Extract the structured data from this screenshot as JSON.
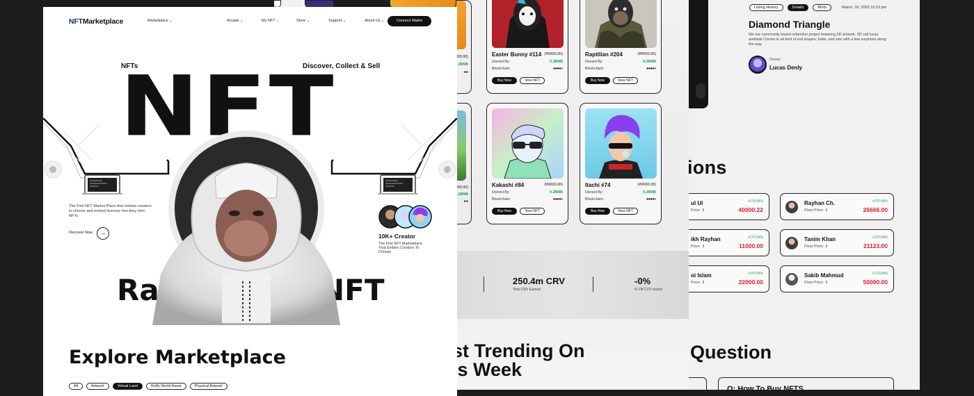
{
  "main": {
    "logo_nft": "NFT",
    "logo_rest": "Marketplace",
    "nav": [
      "Marketplace",
      "Arcade",
      "My NFT",
      "Store",
      "Support",
      "About Us"
    ],
    "connect_button": "Connect Wallet",
    "label_left": "NFTs",
    "label_right": "Discover, Collect & Sell",
    "hero_big_text": "NFT",
    "hero_bottom_left": "Rar",
    "hero_bottom_right": "NFT",
    "intro_text": "The First NFT Market Place that embles creators to choose and embed licenses hen they mint NFTs",
    "discover_link": "Discover Now",
    "discover_arrow": "→",
    "creator_count": "10K+ Creator",
    "creator_desc": "The First NFT Marketplace That Embles Creators To Choose.",
    "explore_title": "Explore Marketplace",
    "filters": [
      "All",
      "Artwork",
      "Virtual Land",
      "Ruffy World Asset",
      "Physical Artwork"
    ],
    "active_filter": "Virtual Land"
  },
  "middle": {
    "cards": [
      {
        "name": "Easter Bunny #114",
        "price": "(¥9000.00)",
        "owned_label": "Owned By:",
        "owned_value": "0.2BNB",
        "chain_label": "Blockchain:",
        "buy": "Buy Now",
        "view": "View NFT"
      },
      {
        "name": "Raptilian #204",
        "price": "(¥9000.00)",
        "owned_label": "Owned By:",
        "owned_value": "0.2BNB",
        "chain_label": "Blockchain:",
        "buy": "Buy Now",
        "view": "View NFT"
      },
      {
        "name": "Kakashi #84",
        "price": "(¥9000.00)",
        "owned_label": "Owned By:",
        "owned_value": "0.2BNB",
        "chain_label": "Blockchain:",
        "buy": "Buy Now",
        "view": "View NFT"
      },
      {
        "name": "Itachi #74",
        "price": "(¥9000.00)",
        "owned_label": "Owned By:",
        "owned_value": "0.2BNB",
        "chain_label": "Blockchain:",
        "buy": "Buy Now",
        "view": "View NFT"
      }
    ],
    "partial": [
      {
        "price": "9000.00)",
        "value": "0.2BNB"
      },
      {
        "price": "9000.00)",
        "value": "0.2BNB"
      }
    ],
    "stats": [
      {
        "value": "250.4m CRV",
        "label": "Total CRV Earned"
      },
      {
        "value": "-0%",
        "label": "% Off CVX locked"
      }
    ],
    "trending_line1": "st Trending On",
    "trending_line2": "is Week"
  },
  "right": {
    "tabs": [
      "Listing History",
      "Details",
      "Birds"
    ],
    "active_tab": "Details",
    "date": "March, 16, 2022  10:12 pm",
    "title": "Diamond Triangle",
    "description": "We are community based collection project featuring 3D artwork. 3D call lucas andrade Comes in all kind of evil shapes, traits, and size with a few surprises along the way.",
    "owner_label": "Owner",
    "owner_name": "Lucas Denly",
    "creators_title": "ions",
    "creators": [
      {
        "name": "ul Ui",
        "floor": "Price:",
        "change": "+570.54%",
        "value": "40000.22"
      },
      {
        "name": "Rayhan Ch.",
        "floor": "Floor Price:",
        "change": "+570.54%",
        "value": "26666.00"
      },
      {
        "name": "ikh Rayhan",
        "floor": "Price:",
        "change": "+570.54%",
        "value": "11000.00"
      },
      {
        "name": "Tanim Khan",
        "floor": "Floor Price:",
        "change": "+270.54%",
        "value": "21123.00"
      },
      {
        "name": "oi Islam",
        "floor": "Price:",
        "change": "+470.54%",
        "value": "22000.00"
      },
      {
        "name": "Sakib Mahmud",
        "floor": "Floor Price:",
        "change": "+170.54%",
        "value": "50000.00"
      }
    ],
    "faq_title": "Question",
    "faq_item": "Q: How To Buy NFTS"
  }
}
